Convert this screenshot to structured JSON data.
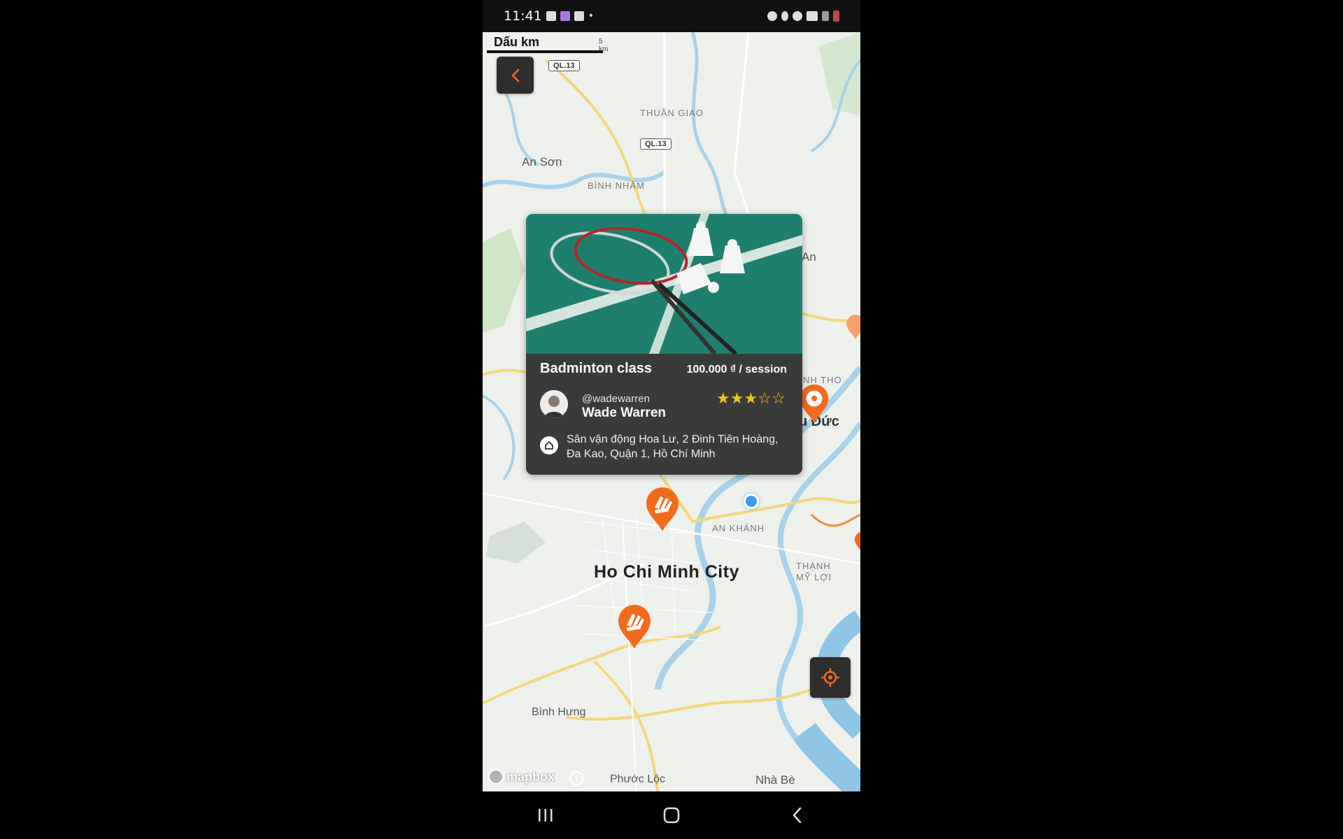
{
  "status_bar": {
    "time": "11:41",
    "icons_left": [
      "qr-icon",
      "app-icon",
      "gallery-icon",
      "dot-icon"
    ],
    "icons_right": [
      "alarm-icon",
      "location-icon",
      "hotspot-icon",
      "data-icon",
      "signal-icon",
      "battery-icon"
    ]
  },
  "map": {
    "scale_label": "Dấu km",
    "scale_unit": "5 km",
    "places": [
      {
        "name": "An Sơn"
      },
      {
        "name": "THUẬN GIAO"
      },
      {
        "name": "BÌNH NHÂM"
      },
      {
        "name": "An"
      },
      {
        "name": "NH THO"
      },
      {
        "name": "u Đức"
      },
      {
        "name": "AN KHÁNH"
      },
      {
        "name": "Ho Chi Minh City"
      },
      {
        "name": "THẠNH MỸ LỢI"
      },
      {
        "name": "Bình Hưng"
      },
      {
        "name": "Phước Lộc"
      },
      {
        "name": "Nhà Bè"
      }
    ],
    "road_shields": [
      "QL.13",
      "QL.13"
    ],
    "attribution": "mapbox"
  },
  "card": {
    "title": "Badminton class",
    "price": "100.000 ₫ / session",
    "host_handle": "@wadewarren",
    "host_name": "Wade Warren",
    "rating": 3,
    "rating_max": 5,
    "address": "Sân vận động Hoa Lư, 2 Đinh Tiên Hoàng, Đa Kao, Quận 1, Hồ Chí Minh"
  },
  "colors": {
    "accent": "#f26b1d",
    "card_bg": "#3a3a3a",
    "star": "#f0c419",
    "user_dot": "#3d9be9"
  }
}
